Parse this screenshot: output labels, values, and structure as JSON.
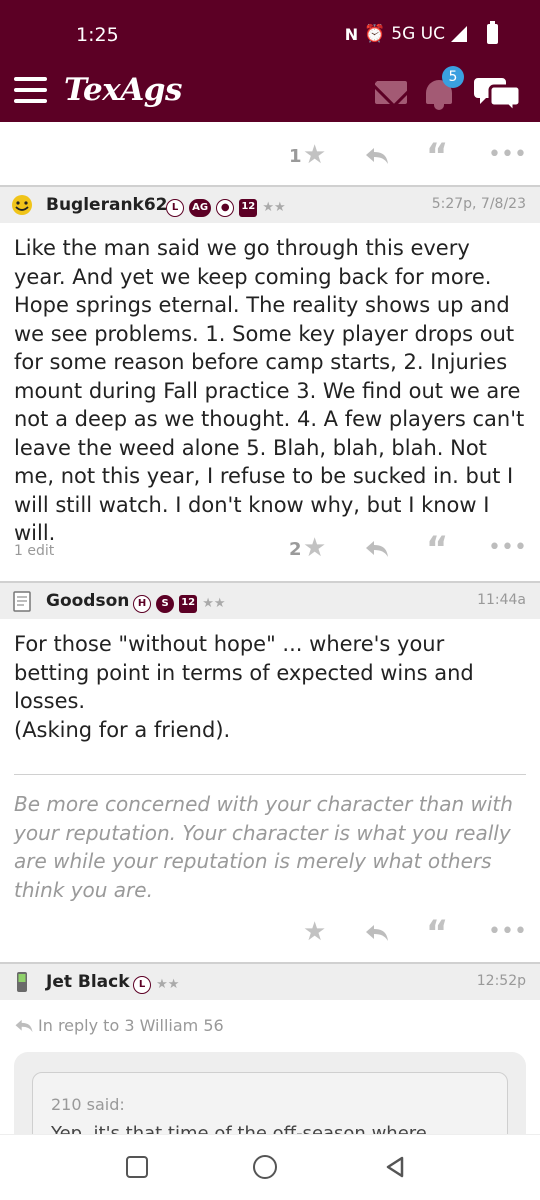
{
  "status_bar": {
    "time": "1:25",
    "network": "5G UC"
  },
  "app_bar": {
    "logo": "TexAgs",
    "notification_count": "5",
    "icons": [
      "menu-icon",
      "mail-icon",
      "bell-icon",
      "chat-icon"
    ]
  },
  "posts": [
    {
      "username": "",
      "body": "",
      "rating": "1",
      "edit": ""
    },
    {
      "username": "Buglerank62",
      "badges": [
        "L",
        "AG",
        "",
        "12"
      ],
      "stars": "★★",
      "time": "5:27p, 7/8/23",
      "body": "Like the man said we go through this every year. And yet we keep coming back for more. Hope springs eternal. The reality shows up and we see problems. 1. Some key player drops out for some reason before camp starts, 2. Injuries mount during Fall practice 3. We find out we are not a deep as we thought. 4. A few players can't leave the weed alone 5. Blah, blah, blah. Not me, not this year, I refuse to be sucked in. but I will still watch. I don't know why, but I know I will.",
      "edit": "1 edit",
      "rating": "2"
    },
    {
      "username": "Goodson",
      "badges": [
        "H",
        "S",
        "12"
      ],
      "stars": "★★",
      "time": "11:44a",
      "body_lines": [
        "For those \"without hope\" ... where's your betting point in terms of expected wins and losses.",
        "(Asking for a friend)."
      ],
      "signature": "Be more concerned with your character than with your reputation. Your character is what you really are while your reputation is merely what others think you are.",
      "rating": ""
    },
    {
      "username": "Jet Black",
      "badges": [
        "L"
      ],
      "stars": "★★",
      "time": "12:52p",
      "reply_to": "In reply to 3 William 56",
      "quote_label": "210 said:",
      "quote_text": "Yep, it's that time of the off-season where"
    }
  ],
  "colors": {
    "maroon": "#5c0025",
    "badge_blue": "#3aa0e0",
    "muted": "#999999"
  }
}
